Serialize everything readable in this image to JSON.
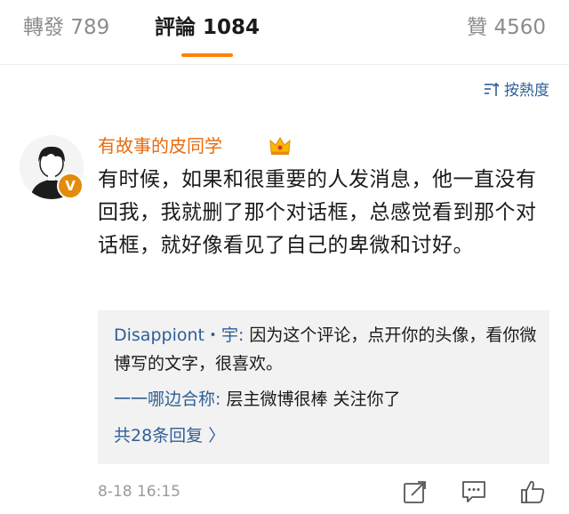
{
  "tabs": {
    "repost": "轉發 789",
    "comments": "評論 1084",
    "likes": "贊 4560"
  },
  "sort_label": "按熱度",
  "comment": {
    "username": "有故事的皮同学",
    "badge": "V",
    "text": "有时候，如果和很重要的人发消息，他一直没有回我，我就删了那个对话框，总感觉看到那个对话框，就好像看见了自己的卑微和讨好。",
    "time": "8-18 16:15"
  },
  "replies": [
    {
      "name": "Disappiont・宇:",
      "text": " 因为这个评论，点开你的头像，看你微博写的文字，很喜欢。"
    },
    {
      "name": "一一哪边合称:",
      "text": " 层主微博很棒 关注你了"
    }
  ],
  "more_replies": "共28条回复 〉",
  "colors": {
    "accent": "#ff8200",
    "username": "#e86b0d",
    "link": "#2f5f96",
    "reply_bg": "#f2f2f2"
  },
  "icons": [
    "sort-icon",
    "crown-icon",
    "share-icon",
    "comment-icon",
    "like-icon"
  ]
}
